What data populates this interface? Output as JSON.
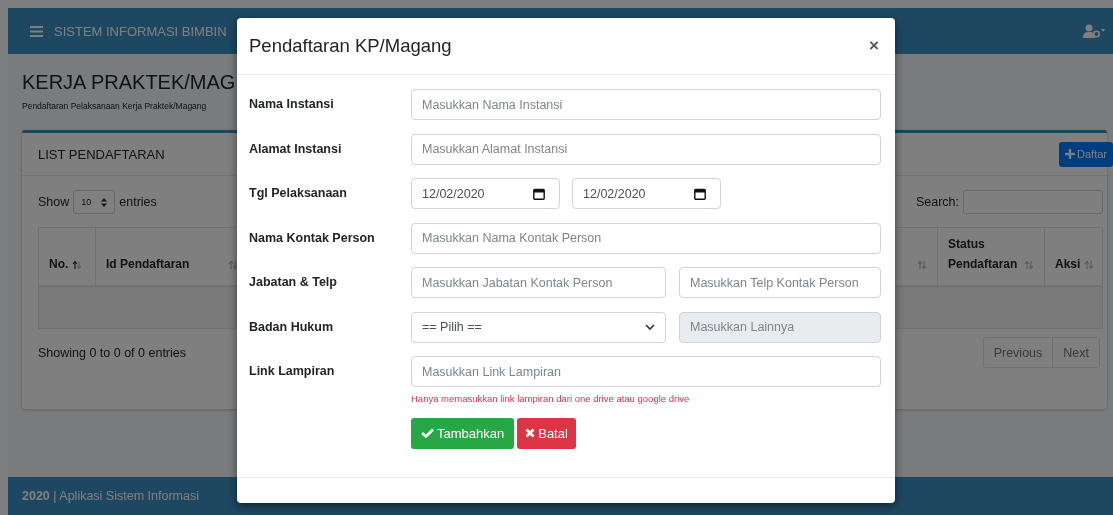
{
  "navbar": {
    "title": "SISTEM INFORMASI BIMBIN"
  },
  "page": {
    "title": "KERJA PRAKTEK/MAG",
    "subtitle": "Pendaftaran Pelaksanaan Kerja Praktek/Magang"
  },
  "card": {
    "title": "LIST PENDAFTARAN",
    "add_button": "Daftar"
  },
  "table_tools": {
    "show_label": "Show",
    "page_size": "10",
    "entries_label": "entries",
    "search_label": "Search:"
  },
  "table": {
    "columns": [
      {
        "label": "No.",
        "sorted": true
      },
      {
        "label": "Id Pendaftaran",
        "sorted": false
      },
      {
        "label": "Status Pendaftaran",
        "sorted": false
      },
      {
        "label": "Aksi",
        "sorted": false
      }
    ]
  },
  "table_info": "Showing 0 to 0 of 0 entries",
  "pagination": [
    "Previous",
    "Next"
  ],
  "footer": {
    "year": "2020",
    "text": "| Aplikasi Sistem Informasi"
  },
  "modal": {
    "title": "Pendaftaran KP/Magang",
    "close": "×",
    "fields": [
      {
        "label": "Nama Instansi",
        "inputs": [
          {
            "kind": "text",
            "placeholder": "Masukkan Nama Instansi",
            "disabled": false
          }
        ]
      },
      {
        "label": "Alamat Instansi",
        "inputs": [
          {
            "kind": "text",
            "placeholder": "Masukkan Alamat Instansi",
            "disabled": false
          }
        ]
      },
      {
        "label": "Tgl Pelaksanaan",
        "inputs": [
          {
            "kind": "date",
            "value": "12/02/2020"
          },
          {
            "kind": "date",
            "value": "12/02/2020"
          }
        ]
      },
      {
        "label": "Nama Kontak Person",
        "inputs": [
          {
            "kind": "text",
            "placeholder": "Masukkan Nama Kontak Person",
            "disabled": false
          }
        ]
      },
      {
        "label": "Jabatan & Telp",
        "inputs": [
          {
            "kind": "text",
            "placeholder": "Masukkan Jabatan Kontak Person",
            "disabled": false
          },
          {
            "kind": "text",
            "placeholder": "Masukkan Telp Kontak Person",
            "disabled": false
          }
        ]
      },
      {
        "label": "Badan Hukum",
        "inputs": [
          {
            "kind": "select",
            "value": "== Pilih =="
          },
          {
            "kind": "text",
            "placeholder": "Masukkan Lainnya",
            "disabled": true
          }
        ]
      },
      {
        "label": "Link Lampiran",
        "inputs": [
          {
            "kind": "text",
            "placeholder": "Masukkan Link Lampiran",
            "disabled": false
          }
        ],
        "help": "Hanya memasukkan link lampiran dari one drive atau google drive"
      }
    ],
    "buttons": [
      {
        "kind": "submit",
        "label": "Tambahkan"
      },
      {
        "kind": "cancel",
        "label": "Batal"
      }
    ]
  }
}
